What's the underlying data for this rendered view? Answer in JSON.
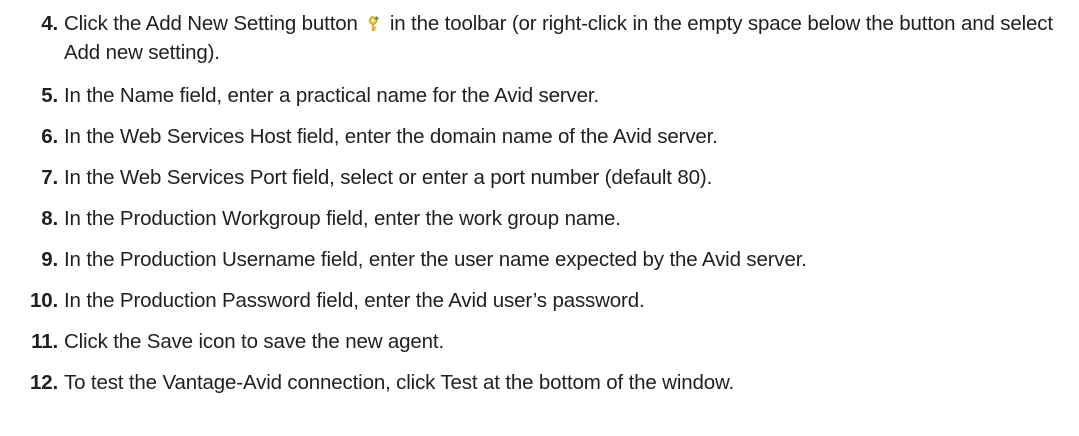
{
  "steps": [
    {
      "number": "4.",
      "text_before_icon": "Click the Add New Setting button",
      "icon": "add-setting-icon",
      "text_after_icon": "in the toolbar (or right-click in the empty space below the button and select Add new setting)."
    },
    {
      "number": "5.",
      "text": "In the Name field, enter a practical name for the Avid server."
    },
    {
      "number": "6.",
      "text": "In the Web Services Host field, enter the domain name of the Avid server."
    },
    {
      "number": "7.",
      "text": "In the Web Services Port field, select or enter a port number (default 80)."
    },
    {
      "number": "8.",
      "text": "In the Production Workgroup field, enter the work group name."
    },
    {
      "number": "9.",
      "text": "In the Production Username field, enter the user name expected by the Avid server."
    },
    {
      "number": "10.",
      "text": "In the Production Password field, enter the Avid user’s password."
    },
    {
      "number": "11.",
      "text": "Click the Save icon to save the new agent."
    },
    {
      "number": "12.",
      "text": "To test the Vantage-Avid connection, click Test at the bottom of the window."
    }
  ],
  "colors": {
    "text": "#231f20",
    "icon_yellow": "#f2c230",
    "icon_plus": "#2e8b3a"
  }
}
